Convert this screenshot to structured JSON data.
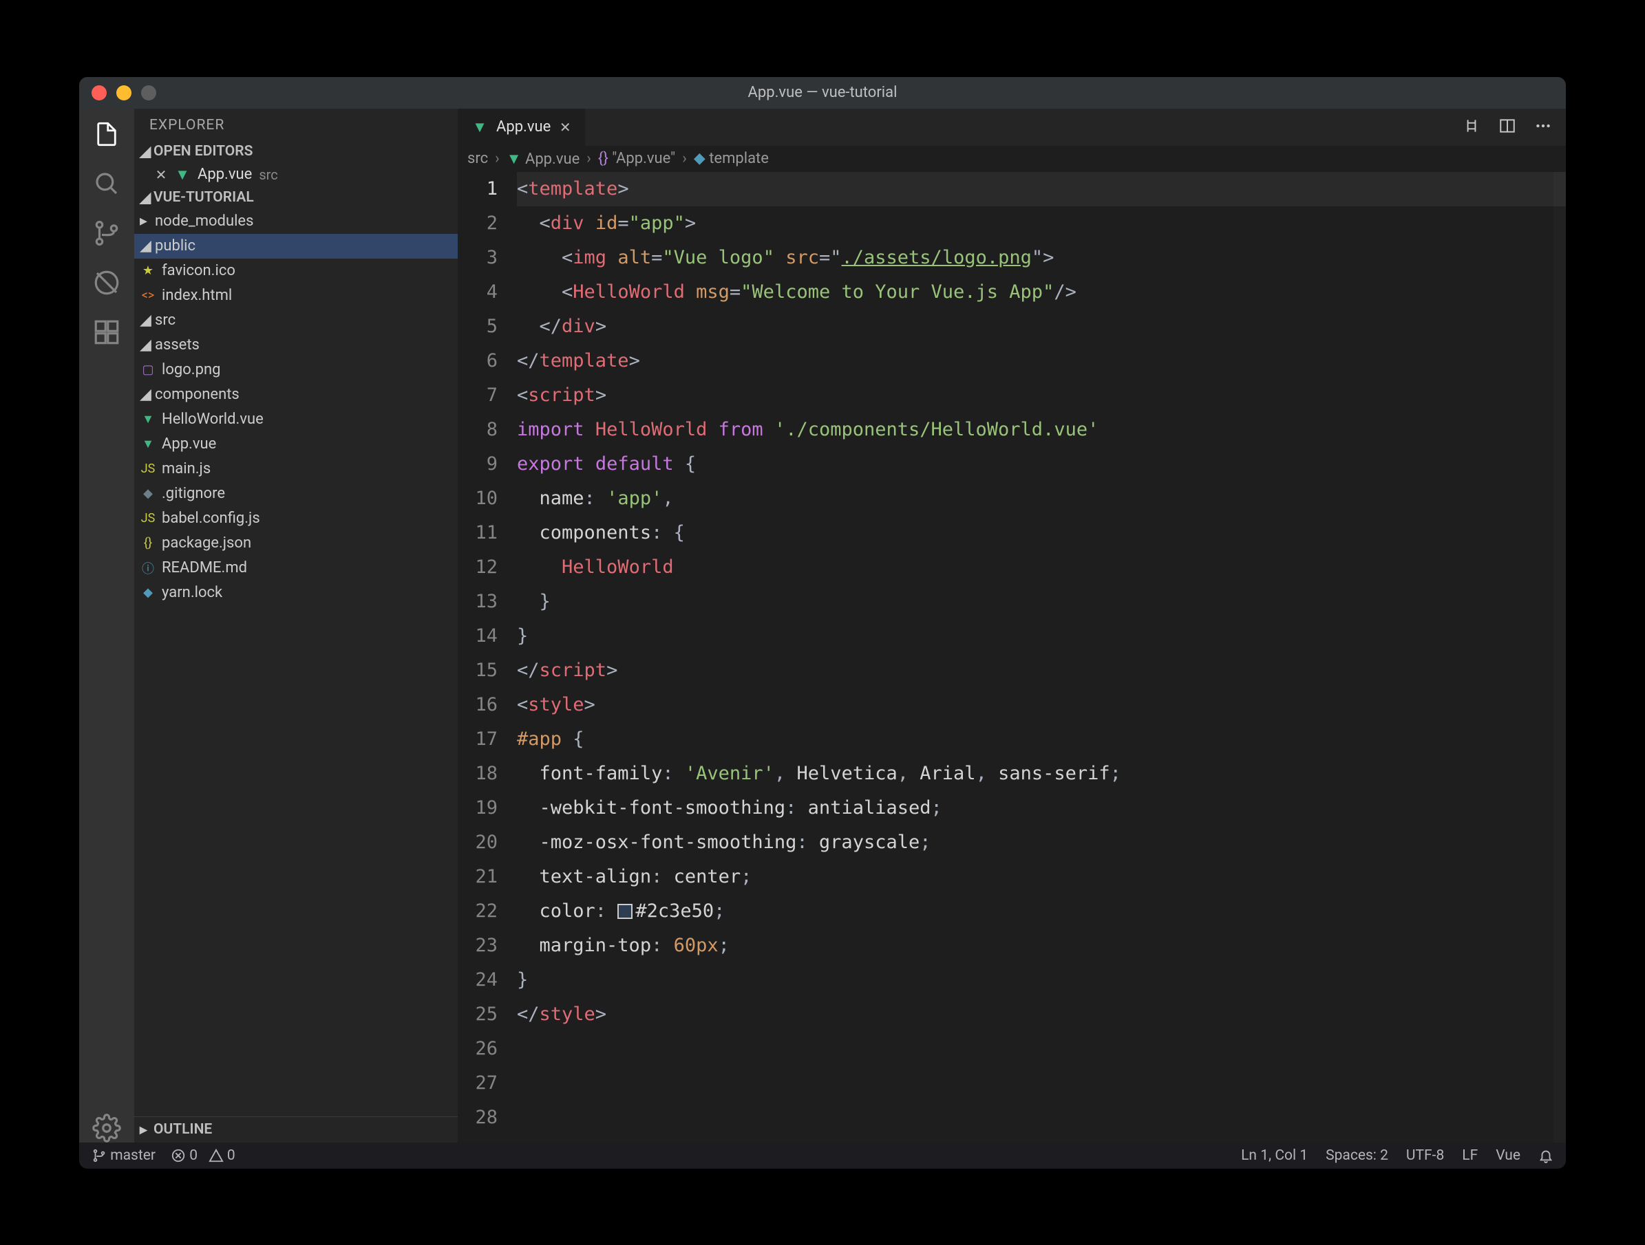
{
  "window": {
    "title": "App.vue — vue-tutorial"
  },
  "sidebar": {
    "title": "EXPLORER",
    "open_editors_label": "OPEN EDITORS",
    "open_editors": [
      {
        "icon": "vue",
        "name": "App.vue",
        "path": "src"
      }
    ],
    "project_label": "VUE-TUTORIAL",
    "outline_label": "OUTLINE",
    "tree": [
      {
        "depth": 1,
        "kind": "folder-closed",
        "name": "node_modules"
      },
      {
        "depth": 1,
        "kind": "folder-open",
        "name": "public",
        "selected": true
      },
      {
        "depth": 2,
        "kind": "favicon",
        "name": "favicon.ico"
      },
      {
        "depth": 2,
        "kind": "html",
        "name": "index.html"
      },
      {
        "depth": 1,
        "kind": "folder-open",
        "name": "src"
      },
      {
        "depth": 2,
        "kind": "folder-open",
        "name": "assets"
      },
      {
        "depth": 3,
        "kind": "image",
        "name": "logo.png"
      },
      {
        "depth": 2,
        "kind": "folder-open",
        "name": "components"
      },
      {
        "depth": 3,
        "kind": "vue",
        "name": "HelloWorld.vue"
      },
      {
        "depth": 2,
        "kind": "vue",
        "name": "App.vue"
      },
      {
        "depth": 2,
        "kind": "js",
        "name": "main.js"
      },
      {
        "depth": 1,
        "kind": "git",
        "name": ".gitignore"
      },
      {
        "depth": 1,
        "kind": "js",
        "name": "babel.config.js"
      },
      {
        "depth": 1,
        "kind": "json",
        "name": "package.json"
      },
      {
        "depth": 1,
        "kind": "info",
        "name": "README.md"
      },
      {
        "depth": 1,
        "kind": "yarn",
        "name": "yarn.lock"
      }
    ]
  },
  "tab": {
    "name": "App.vue"
  },
  "breadcrumbs": {
    "parts": [
      "src",
      "App.vue",
      "\"App.vue\"",
      "template"
    ]
  },
  "code": {
    "lines": [
      {
        "n": 1,
        "active": true,
        "seg": [
          [
            "punct",
            "<"
          ],
          [
            "tag",
            "template"
          ],
          [
            "punct",
            ">"
          ]
        ]
      },
      {
        "n": 2,
        "seg": [
          [
            "pl",
            "  "
          ],
          [
            "punct",
            "<"
          ],
          [
            "tag",
            "div"
          ],
          [
            "pl",
            " "
          ],
          [
            "attr",
            "id"
          ],
          [
            "punct",
            "="
          ],
          [
            "str",
            "\"app\""
          ],
          [
            "punct",
            ">"
          ]
        ]
      },
      {
        "n": 3,
        "seg": [
          [
            "pl",
            "    "
          ],
          [
            "punct",
            "<"
          ],
          [
            "tag",
            "img"
          ],
          [
            "pl",
            " "
          ],
          [
            "attr",
            "alt"
          ],
          [
            "punct",
            "="
          ],
          [
            "str",
            "\"Vue logo\""
          ],
          [
            "pl",
            " "
          ],
          [
            "attr",
            "src"
          ],
          [
            "punct",
            "=\""
          ],
          [
            "str-u",
            "./assets/logo.png"
          ],
          [
            "punct",
            "\">"
          ]
        ]
      },
      {
        "n": 4,
        "seg": [
          [
            "pl",
            "    "
          ],
          [
            "punct",
            "<"
          ],
          [
            "comp",
            "HelloWorld"
          ],
          [
            "pl",
            " "
          ],
          [
            "attr",
            "msg"
          ],
          [
            "punct",
            "="
          ],
          [
            "str",
            "\"Welcome to Your Vue.js App\""
          ],
          [
            "punct",
            "/>"
          ]
        ]
      },
      {
        "n": 5,
        "seg": [
          [
            "pl",
            "  "
          ],
          [
            "punct",
            "</"
          ],
          [
            "tag",
            "div"
          ],
          [
            "punct",
            ">"
          ]
        ]
      },
      {
        "n": 6,
        "seg": [
          [
            "punct",
            "</"
          ],
          [
            "tag",
            "template"
          ],
          [
            "punct",
            ">"
          ]
        ]
      },
      {
        "n": 7,
        "seg": [
          [
            "pl",
            ""
          ]
        ]
      },
      {
        "n": 8,
        "seg": [
          [
            "punct",
            "<"
          ],
          [
            "tag",
            "script"
          ],
          [
            "punct",
            ">"
          ]
        ]
      },
      {
        "n": 9,
        "seg": [
          [
            "key",
            "import"
          ],
          [
            "pl",
            " "
          ],
          [
            "em",
            "HelloWorld"
          ],
          [
            "pl",
            " "
          ],
          [
            "key",
            "from"
          ],
          [
            "pl",
            " "
          ],
          [
            "str",
            "'./components/HelloWorld.vue'"
          ]
        ]
      },
      {
        "n": 10,
        "seg": [
          [
            "pl",
            ""
          ]
        ]
      },
      {
        "n": 11,
        "seg": [
          [
            "key",
            "export"
          ],
          [
            "pl",
            " "
          ],
          [
            "key",
            "default"
          ],
          [
            "pl",
            " "
          ],
          [
            "punct",
            "{"
          ]
        ]
      },
      {
        "n": 12,
        "seg": [
          [
            "pl",
            "  "
          ],
          [
            "prop",
            "name"
          ],
          [
            "punct",
            ":"
          ],
          [
            "pl",
            " "
          ],
          [
            "str",
            "'app'"
          ],
          [
            "punct",
            ","
          ]
        ]
      },
      {
        "n": 13,
        "seg": [
          [
            "pl",
            "  "
          ],
          [
            "prop",
            "components"
          ],
          [
            "punct",
            ":"
          ],
          [
            "pl",
            " "
          ],
          [
            "punct",
            "{"
          ]
        ]
      },
      {
        "n": 14,
        "seg": [
          [
            "pl",
            "    "
          ],
          [
            "em",
            "HelloWorld"
          ]
        ]
      },
      {
        "n": 15,
        "seg": [
          [
            "pl",
            "  "
          ],
          [
            "punct",
            "}"
          ]
        ]
      },
      {
        "n": 16,
        "seg": [
          [
            "punct",
            "}"
          ]
        ]
      },
      {
        "n": 17,
        "seg": [
          [
            "punct",
            "</"
          ],
          [
            "tag",
            "script"
          ],
          [
            "punct",
            ">"
          ]
        ]
      },
      {
        "n": 18,
        "seg": [
          [
            "pl",
            ""
          ]
        ]
      },
      {
        "n": 19,
        "seg": [
          [
            "punct",
            "<"
          ],
          [
            "tag",
            "style"
          ],
          [
            "punct",
            ">"
          ]
        ]
      },
      {
        "n": 20,
        "seg": [
          [
            "sel",
            "#app"
          ],
          [
            "pl",
            " "
          ],
          [
            "punct",
            "{"
          ]
        ]
      },
      {
        "n": 21,
        "seg": [
          [
            "pl",
            "  "
          ],
          [
            "prop",
            "font-family"
          ],
          [
            "punct",
            ":"
          ],
          [
            "pl",
            " "
          ],
          [
            "css-str",
            "'Avenir'"
          ],
          [
            "punct",
            ","
          ],
          [
            "pl",
            " "
          ],
          [
            "prop",
            "Helvetica"
          ],
          [
            "punct",
            ","
          ],
          [
            "pl",
            " "
          ],
          [
            "prop",
            "Arial"
          ],
          [
            "punct",
            ","
          ],
          [
            "pl",
            " "
          ],
          [
            "prop",
            "sans-serif"
          ],
          [
            "punct",
            ";"
          ]
        ]
      },
      {
        "n": 22,
        "seg": [
          [
            "pl",
            "  "
          ],
          [
            "prop",
            "-webkit-font-smoothing"
          ],
          [
            "punct",
            ":"
          ],
          [
            "pl",
            " "
          ],
          [
            "prop",
            "antialiased"
          ],
          [
            "punct",
            ";"
          ]
        ]
      },
      {
        "n": 23,
        "seg": [
          [
            "pl",
            "  "
          ],
          [
            "prop",
            "-moz-osx-font-smoothing"
          ],
          [
            "punct",
            ":"
          ],
          [
            "pl",
            " "
          ],
          [
            "prop",
            "grayscale"
          ],
          [
            "punct",
            ";"
          ]
        ]
      },
      {
        "n": 24,
        "seg": [
          [
            "pl",
            "  "
          ],
          [
            "prop",
            "text-align"
          ],
          [
            "punct",
            ":"
          ],
          [
            "pl",
            " "
          ],
          [
            "prop",
            "center"
          ],
          [
            "punct",
            ";"
          ]
        ]
      },
      {
        "n": 25,
        "seg": [
          [
            "pl",
            "  "
          ],
          [
            "prop",
            "color"
          ],
          [
            "punct",
            ":"
          ],
          [
            "pl",
            " "
          ],
          [
            "colorbox",
            "#2c3e50"
          ],
          [
            "prop",
            "#2c3e50"
          ],
          [
            "punct",
            ";"
          ]
        ]
      },
      {
        "n": 26,
        "seg": [
          [
            "pl",
            "  "
          ],
          [
            "prop",
            "margin-top"
          ],
          [
            "punct",
            ":"
          ],
          [
            "pl",
            " "
          ],
          [
            "val",
            "60px"
          ],
          [
            "punct",
            ";"
          ]
        ]
      },
      {
        "n": 27,
        "seg": [
          [
            "punct",
            "}"
          ]
        ]
      },
      {
        "n": 28,
        "seg": [
          [
            "punct",
            "</"
          ],
          [
            "tag",
            "style"
          ],
          [
            "punct",
            ">"
          ]
        ]
      }
    ]
  },
  "status": {
    "branch": "master",
    "errors": "0",
    "warnings": "0",
    "pos": "Ln 1, Col 1",
    "spaces": "Spaces: 2",
    "encoding": "UTF-8",
    "eol": "LF",
    "lang": "Vue"
  },
  "icons": {
    "vue": "▼",
    "html": "<>",
    "favicon": "★",
    "image": "▢",
    "js": "JS",
    "json": "{}",
    "info": "ⓘ",
    "git": "◆",
    "yarn": "◆"
  }
}
